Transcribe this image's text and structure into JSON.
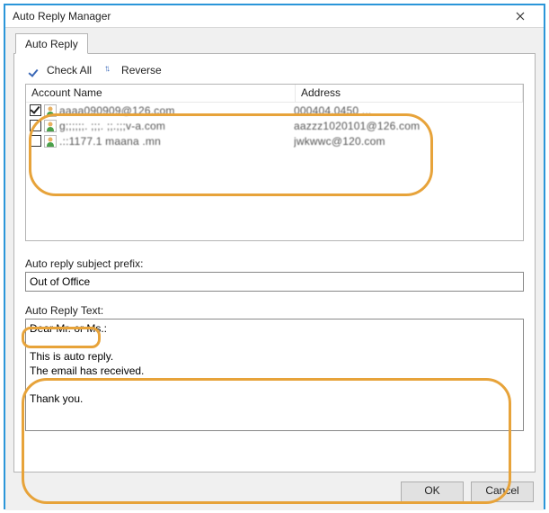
{
  "window": {
    "title": "Auto Reply Manager"
  },
  "tabs": [
    {
      "label": "Auto Reply"
    }
  ],
  "actions": {
    "check_all": "Check All",
    "reverse": "Reverse"
  },
  "columns": {
    "name": "Account Name",
    "address": "Address"
  },
  "accounts": [
    {
      "checked": true,
      "name": "aaaa090909@126.com",
      "address": "000404.0450 ..."
    },
    {
      "checked": false,
      "name": "g;;;;;;. ;;;. ;;.;;;v-a.com",
      "address": "aazzz1020101@126.com"
    },
    {
      "checked": false,
      "name": ".::1177.1 maana .mn",
      "address": "jwkwwc@120.com"
    }
  ],
  "labels": {
    "subject_prefix": "Auto reply subject prefix:",
    "reply_text": "Auto Reply Text:"
  },
  "inputs": {
    "subject_prefix": "Out of Office",
    "reply_text": "Dear Mr. or Ms.:\n\nThis is auto reply.\nThe email has received.\n\nThank you.\n"
  },
  "buttons": {
    "ok": "OK",
    "cancel": "Cancel"
  }
}
